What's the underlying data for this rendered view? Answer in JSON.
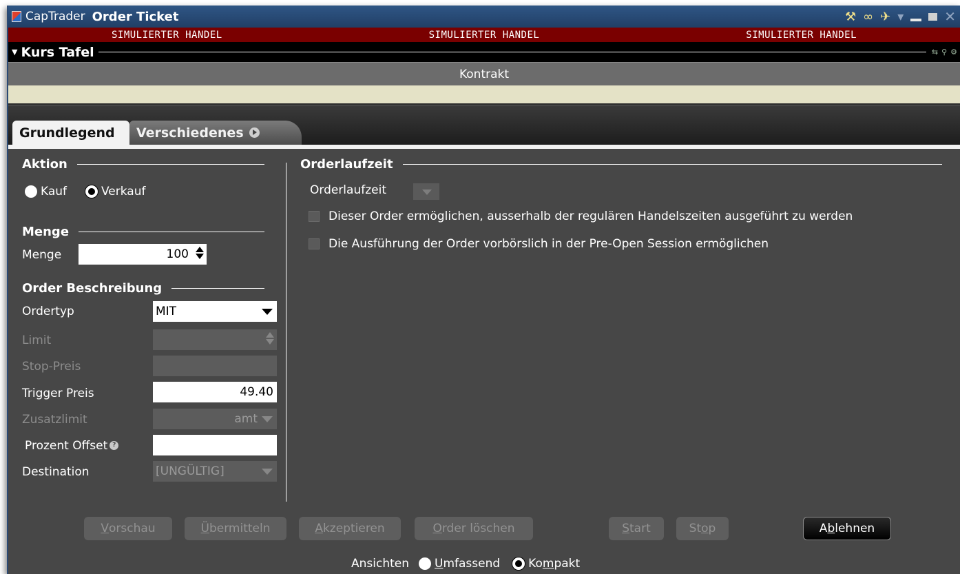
{
  "window": {
    "app_name": "CapTrader",
    "title": "Order Ticket",
    "title_icons": [
      "wrench-icon",
      "link-icon",
      "pin-icon",
      "dropdown-icon",
      "minimize-icon",
      "maximize-icon",
      "close-icon"
    ]
  },
  "sim_banner": [
    "SIMULIERTER HANDEL",
    "SIMULIERTER HANDEL",
    "SIMULIERTER HANDEL"
  ],
  "kurs_tafel": {
    "title": "Kurs Tafel",
    "column_header": "Kontrakt"
  },
  "tabs": [
    {
      "label": "Grundlegend",
      "active": true
    },
    {
      "label": "Verschiedenes",
      "active": false
    }
  ],
  "aktion": {
    "title": "Aktion",
    "buy_label": "Kauf",
    "sell_label": "Verkauf",
    "selected": "Verkauf"
  },
  "menge": {
    "title": "Menge",
    "label": "Menge",
    "value": "100"
  },
  "order": {
    "title": "Order Beschreibung",
    "ordertyp_label": "Ordertyp",
    "ordertyp_value": "MIT",
    "limit_label": "Limit",
    "stop_label": "Stop-Preis",
    "trigger_label": "Trigger Preis",
    "trigger_value": "49.40",
    "zusatz_label": "Zusatzlimit",
    "zusatz_value": "amt",
    "offset_label": "Prozent Offset",
    "destination_label": "Destination",
    "destination_value": "[UNGÜLTIG]"
  },
  "laufzeit": {
    "title": "Orderlaufzeit",
    "label": "Orderlaufzeit",
    "option1": "Dieser Order ermöglichen, ausserhalb der regulären Handelszeiten ausgeführt zu werden",
    "option2": "Die Ausführung der Order vorbörslich in der Pre-Open Session ermöglichen"
  },
  "buttons": {
    "preview": {
      "u": "V",
      "rest": "orschau"
    },
    "transmit": {
      "u": "Ü",
      "rest": "bermitteln"
    },
    "accept": {
      "u": "A",
      "rest": "kzeptieren"
    },
    "delete": {
      "u": "O",
      "rest": "rder löschen"
    },
    "start": {
      "u": "S",
      "rest": "tart"
    },
    "stop": {
      "pre": "St",
      "u": "o",
      "rest": "p"
    },
    "reject": {
      "pre": "A",
      "u": "b",
      "rest": "lehnen"
    }
  },
  "views": {
    "label": "Ansichten",
    "option1_u": "U",
    "option1_rest": "mfassend",
    "option2_pre": "Ko",
    "option2_u": "m",
    "option2_rest": "pakt",
    "selected": "Kompakt"
  },
  "colors": {
    "sim_banner": "#7a0000",
    "titlebar": "#2f5685",
    "panel": "#474747",
    "kontrakt_row": "#e4e2c6"
  }
}
